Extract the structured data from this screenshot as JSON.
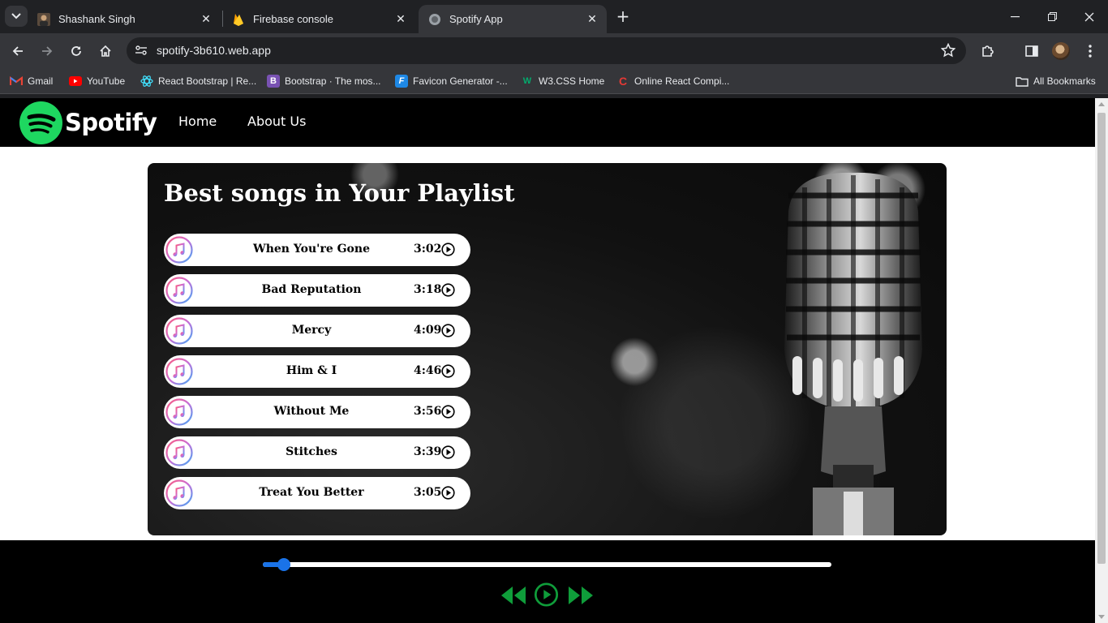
{
  "browser": {
    "tabs": [
      {
        "title": "Shashank Singh",
        "icon": "profile-photo-icon"
      },
      {
        "title": "Firebase console",
        "icon": "firebase-icon"
      },
      {
        "title": "Spotify App",
        "icon": "globe-icon",
        "active": true
      }
    ],
    "url": "spotify-3b610.web.app",
    "bookmarks": [
      {
        "label": "Gmail",
        "icon": "gmail-icon"
      },
      {
        "label": "YouTube",
        "icon": "youtube-icon"
      },
      {
        "label": "React Bootstrap | Re...",
        "icon": "react-bootstrap-icon"
      },
      {
        "label": "Bootstrap · The mos...",
        "icon": "bootstrap-icon"
      },
      {
        "label": "Favicon Generator -...",
        "icon": "favicon-generator-icon"
      },
      {
        "label": "W3.CSS Home",
        "icon": "w3css-icon"
      },
      {
        "label": "Online React Compi...",
        "icon": "online-compiler-icon"
      }
    ],
    "all_bookmarks": "All Bookmarks"
  },
  "app": {
    "brand": "Spotify",
    "nav": {
      "home": "Home",
      "about": "About Us"
    },
    "hero_title": "Best songs in Your Playlist",
    "songs": [
      {
        "name": "When You're Gone",
        "duration": "3:02"
      },
      {
        "name": "Bad Reputation",
        "duration": "3:18"
      },
      {
        "name": "Mercy",
        "duration": "4:09"
      },
      {
        "name": "Him & I",
        "duration": "4:46"
      },
      {
        "name": "Without Me",
        "duration": "3:56"
      },
      {
        "name": "Stitches",
        "duration": "3:39"
      },
      {
        "name": "Treat You Better",
        "duration": "3:05"
      }
    ],
    "player": {
      "progress": 0.025,
      "colors": {
        "accent": "#1db954",
        "seek": "#1a73e8"
      }
    }
  }
}
